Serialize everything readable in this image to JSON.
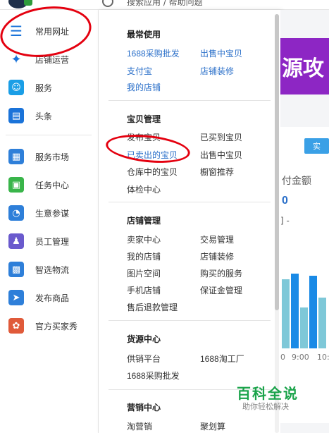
{
  "topbar": {
    "search_text": "搜索应用 / 帮助问题"
  },
  "sidebar": {
    "items": [
      {
        "label": "常用网址",
        "icon": "list-icon",
        "color": "#1a73d9"
      },
      {
        "label": "店铺运营",
        "icon": "compass-icon",
        "color": "#1a73d9"
      },
      {
        "label": "服务",
        "icon": "bag-icon",
        "color": "#1a9ee6"
      },
      {
        "label": "头条",
        "icon": "news-icon",
        "color": "#1a73d9"
      },
      {
        "label": "服务市场",
        "icon": "market-icon",
        "color": "#2e7fd9"
      },
      {
        "label": "任务中心",
        "icon": "task-icon",
        "color": "#39b54a"
      },
      {
        "label": "生意参谋",
        "icon": "chart-icon",
        "color": "#2e7fd9"
      },
      {
        "label": "员工管理",
        "icon": "staff-icon",
        "color": "#6a5acd"
      },
      {
        "label": "智选物流",
        "icon": "logistics-icon",
        "color": "#2e7fd9"
      },
      {
        "label": "发布商品",
        "icon": "send-icon",
        "color": "#2e7fd9"
      },
      {
        "label": "官方买家秀",
        "icon": "buyer-show-icon",
        "color": "#e05a3a"
      }
    ]
  },
  "menu": {
    "sections": [
      {
        "title": "最常使用",
        "links": [
          "1688采购批发",
          "出售中宝贝",
          "支付宝",
          "店铺装修",
          "我的店铺"
        ]
      },
      {
        "title": "宝贝管理",
        "links": [
          "发布宝贝",
          "已买到宝贝",
          "已卖出的宝贝",
          "出售中宝贝",
          "仓库中的宝贝",
          "橱窗推荐",
          "体检中心"
        ]
      },
      {
        "title": "店铺管理",
        "links": [
          "卖家中心",
          "交易管理",
          "我的店铺",
          "店铺装修",
          "图片空间",
          "购买的服务",
          "手机店铺",
          "保证金管理",
          "售后退款管理"
        ]
      },
      {
        "title": "货源中心",
        "links": [
          "供销平台",
          "1688淘工厂",
          "1688采购批发"
        ]
      },
      {
        "title": "营销中心",
        "links": [
          "淘营销",
          "聚划算"
        ]
      }
    ]
  },
  "right": {
    "banner_text": "源攻",
    "button_label": "实",
    "label": "付金额",
    "value": "0",
    "small": "] -",
    "ticks": [
      "0",
      "9:00",
      "10:"
    ],
    "bars": [
      {
        "h": 0.82,
        "color": "#7ec8d8"
      },
      {
        "h": 0.88,
        "color": "#1a8ae6"
      },
      {
        "h": 0.48,
        "color": "#7ec8d8"
      },
      {
        "h": 0.86,
        "color": "#1a8ae6"
      },
      {
        "h": 0.6,
        "color": "#7ec8d8"
      }
    ]
  },
  "watermark": {
    "title": "百科全说",
    "subtitle": "助你轻松解决"
  }
}
